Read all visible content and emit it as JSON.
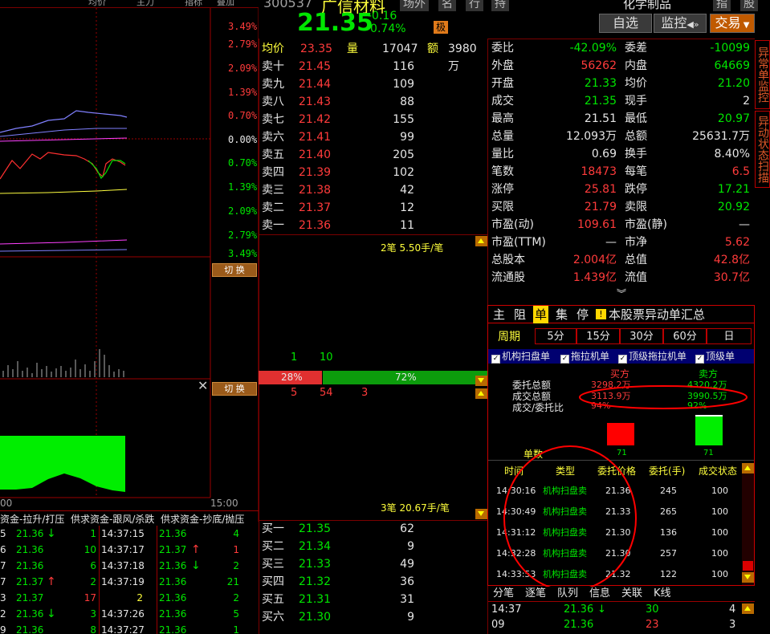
{
  "header": {
    "stock_code": "300537",
    "stock_name": "广信材料",
    "price": "21.35",
    "change": "-0.16",
    "change_pct": "-0.74%",
    "tag": "极",
    "sector": "化学制品",
    "top_tabs": [
      "场外",
      "名",
      "行",
      "持"
    ],
    "top_tabs2": [
      "指",
      "股"
    ],
    "toolbar": {
      "watch": "自选",
      "monitor": "监控",
      "trade": "交易"
    },
    "chart_tabs": [
      "均价",
      "主力",
      "指标",
      "叠加"
    ]
  },
  "left_chart": {
    "pct_labels": [
      "3.49%",
      "2.79%",
      "2.09%",
      "1.39%",
      "0.70%",
      "0.00%",
      "0.70%",
      "1.39%",
      "2.09%",
      "2.79%",
      "3.49%"
    ],
    "switch1": "切 换",
    "switch2": "切 换",
    "time_end": "15:00",
    "time_start": "00"
  },
  "orderbook": {
    "avg_label": "均价",
    "avg_value": "23.35",
    "vol_label": "量",
    "vol_value": "17047",
    "amt_label": "额",
    "amt_value": "3980万",
    "asks": [
      {
        "label": "卖十",
        "price": "21.45",
        "vol": "116"
      },
      {
        "label": "卖九",
        "price": "21.44",
        "vol": "109"
      },
      {
        "label": "卖八",
        "price": "21.43",
        "vol": "88"
      },
      {
        "label": "卖七",
        "price": "21.42",
        "vol": "155"
      },
      {
        "label": "卖六",
        "price": "21.41",
        "vol": "99"
      },
      {
        "label": "卖五",
        "price": "21.40",
        "vol": "205"
      },
      {
        "label": "卖四",
        "price": "21.39",
        "vol": "102"
      },
      {
        "label": "卖三",
        "price": "21.38",
        "vol": "42"
      },
      {
        "label": "卖二",
        "price": "21.37",
        "vol": "12"
      },
      {
        "label": "卖一",
        "price": "21.36",
        "vol": "11"
      }
    ],
    "ask_queue": "2笔 5.50手/笔",
    "count_a": "1",
    "count_b": "10",
    "ratio_left": "28%",
    "ratio_right": "72%",
    "ratio_pct": 28,
    "count_c": "5",
    "count_d": "54",
    "count_e": "3",
    "bid_queue": "3笔 20.67手/笔",
    "bids": [
      {
        "label": "买一",
        "price": "21.35",
        "vol": "62"
      },
      {
        "label": "买二",
        "price": "21.34",
        "vol": "9"
      },
      {
        "label": "买三",
        "price": "21.33",
        "vol": "49"
      },
      {
        "label": "买四",
        "price": "21.32",
        "vol": "36"
      },
      {
        "label": "买五",
        "price": "21.31",
        "vol": "31"
      },
      {
        "label": "买六",
        "price": "21.30",
        "vol": "9"
      }
    ]
  },
  "fundamentals": [
    {
      "l1": "委比",
      "v1": "-42.09%",
      "c1": "green",
      "l2": "委差",
      "v2": "-10099",
      "c2": "green"
    },
    {
      "l1": "外盘",
      "v1": "56262",
      "c1": "red",
      "l2": "内盘",
      "v2": "64669",
      "c2": "green"
    },
    {
      "l1": "开盘",
      "v1": "21.33",
      "c1": "green",
      "l2": "均价",
      "v2": "21.20",
      "c2": "green"
    },
    {
      "l1": "成交",
      "v1": "21.35",
      "c1": "green",
      "l2": "现手",
      "v2": "2",
      "c2": "white"
    },
    {
      "l1": "最高",
      "v1": "21.51",
      "c1": "white",
      "l2": "最低",
      "v2": "20.97",
      "c2": "green"
    },
    {
      "l1": "总量",
      "v1": "12.093万",
      "c1": "white",
      "l2": "总额",
      "v2": "25631.7万",
      "c2": "white"
    },
    {
      "l1": "量比",
      "v1": "0.69",
      "c1": "white",
      "l2": "换手",
      "v2": "8.40%",
      "c2": "white"
    },
    {
      "l1": "笔数",
      "v1": "18473",
      "c1": "red",
      "l2": "每笔",
      "v2": "6.5",
      "c2": "red"
    },
    {
      "l1": "涨停",
      "v1": "25.81",
      "c1": "red",
      "l2": "跌停",
      "v2": "17.21",
      "c2": "green"
    },
    {
      "l1": "买限",
      "v1": "21.79",
      "c1": "red",
      "l2": "卖限",
      "v2": "20.92",
      "c2": "green"
    },
    {
      "l1": "市盈(动)",
      "v1": "109.61",
      "c1": "red",
      "l2": "市盈(静)",
      "v2": "—",
      "c2": "white"
    },
    {
      "l1": "市盈(TTM)",
      "v1": "—",
      "c1": "white",
      "l2": "市净",
      "v2": "5.62",
      "c2": "red"
    },
    {
      "l1": "总股本",
      "v1": "2.004亿",
      "c1": "red",
      "l2": "总值",
      "v2": "42.8亿",
      "c2": "red"
    },
    {
      "l1": "流通股",
      "v1": "1.439亿",
      "c1": "red",
      "l2": "流值",
      "v2": "30.7亿",
      "c2": "red"
    }
  ],
  "anomaly": {
    "tabs": [
      "主",
      "阻",
      "单",
      "集",
      "停"
    ],
    "title": "本股票异动单汇总",
    "period_label": "周期",
    "periods": [
      "5分",
      "15分",
      "30分",
      "60分",
      "日"
    ],
    "filters": [
      "机构扫盘单",
      "拖拉机单",
      "顶级拖拉机单",
      "顶级单"
    ],
    "buy_header": "买方",
    "sell_header": "卖方",
    "rows": [
      {
        "label": "委托总额",
        "buy": "3298.2万",
        "sell": "4320.2万"
      },
      {
        "label": "成交总额",
        "buy": "3113.9万",
        "sell": "3990.5万"
      },
      {
        "label": "成交/委托比",
        "buy": "94%",
        "sell": "92%"
      }
    ],
    "count_label": "单数",
    "buy_count": "71",
    "sell_count": "71",
    "table_headers": [
      "时间",
      "类型",
      "委托价格",
      "委托(手)",
      "成交状态"
    ],
    "table": [
      {
        "t": "14:30:16",
        "type": "机构扫盘卖",
        "p": "21.36",
        "q": "245",
        "s": "100"
      },
      {
        "t": "14:30:49",
        "type": "机构扫盘卖",
        "p": "21.33",
        "q": "265",
        "s": "100"
      },
      {
        "t": "14:31:12",
        "type": "机构扫盘卖",
        "p": "21.30",
        "q": "136",
        "s": "100"
      },
      {
        "t": "14:32:28",
        "type": "机构扫盘卖",
        "p": "21.30",
        "q": "257",
        "s": "100"
      },
      {
        "t": "14:33:53",
        "type": "机构扫盘卖",
        "p": "21.32",
        "q": "122",
        "s": "100"
      }
    ]
  },
  "side_tabs": [
    "异常单监控",
    "异动状态扫描"
  ],
  "bottom_tabs": [
    "分笔",
    "逐笔",
    "队列",
    "信息",
    "关联",
    "K线"
  ],
  "trades_right": [
    {
      "t": "14:37",
      "p": "21.36",
      "q": "30",
      "n": "4"
    },
    {
      "t": "09",
      "p": "21.36",
      "q": "23",
      "n": "3"
    }
  ],
  "tick_header": "资金-拉升/打压  供求资金-跟风/杀跌  供求资金-抄底/抛压",
  "ticks": [
    {
      "a": "5",
      "p1": "21.36",
      "d1": "down",
      "q1": "1",
      "t": "14:37:15",
      "p2": "21.36",
      "d2": "",
      "q2": "4"
    },
    {
      "a": "6",
      "p1": "21.36",
      "d1": "",
      "q1": "10",
      "t": "14:37:17",
      "p2": "21.37",
      "d2": "up",
      "q2": "1"
    },
    {
      "a": "7",
      "p1": "21.36",
      "d1": "",
      "q1": "6",
      "t": "14:37:18",
      "p2": "21.36",
      "d2": "down",
      "q2": "2"
    },
    {
      "a": "7",
      "p1": "21.37",
      "d1": "up",
      "q1": "2",
      "t": "14:37:19",
      "p2": "21.36",
      "d2": "",
      "q2": "21"
    },
    {
      "a": "3",
      "p1": "21.37",
      "d1": "",
      "q1": "17",
      "t": "2",
      "p2": "21.36",
      "d2": "",
      "q2": "2"
    },
    {
      "a": "2",
      "p1": "21.36",
      "d1": "down",
      "q1": "3",
      "t": "14:37:26",
      "p2": "21.36",
      "d2": "",
      "q2": "5"
    },
    {
      "a": "9",
      "p1": "21.36",
      "d1": "",
      "q1": "8",
      "t": "14:37:27",
      "p2": "21.36",
      "d2": "",
      "q2": "1"
    }
  ]
}
